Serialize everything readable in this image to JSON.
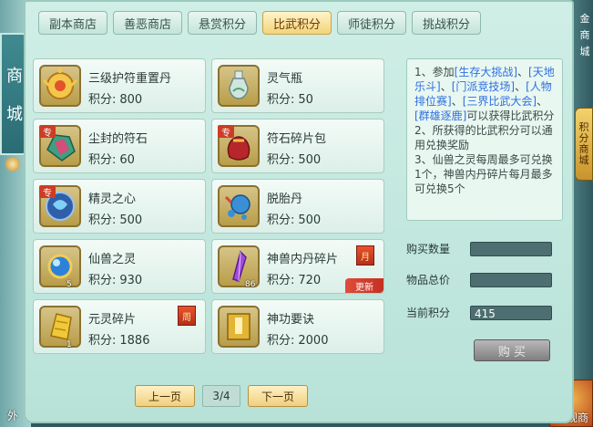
{
  "left_tab": {
    "chars": [
      "商",
      "城"
    ]
  },
  "right_top": {
    "chars": [
      "金",
      "商",
      "城"
    ]
  },
  "right_tab": {
    "chars": [
      "积",
      "分",
      "商",
      "城"
    ]
  },
  "corner": {
    "right_label": "外观商",
    "left_label": "外"
  },
  "tabs": [
    {
      "label": "副本商店",
      "active": false
    },
    {
      "label": "善恶商店",
      "active": false
    },
    {
      "label": "悬赏积分",
      "active": false
    },
    {
      "label": "比武积分",
      "active": true
    },
    {
      "label": "师徒积分",
      "active": false
    },
    {
      "label": "挑战积分",
      "active": false
    }
  ],
  "items": [
    {
      "name": "三级护符重置丹",
      "points_label": "积分:",
      "points": "800",
      "icon": "amulet-pill-icon"
    },
    {
      "name": "灵气瓶",
      "points_label": "积分:",
      "points": "50",
      "icon": "spirit-bottle-icon"
    },
    {
      "name": "尘封的符石",
      "points_label": "积分:",
      "points": "60",
      "icon": "dusty-runestone-icon",
      "badge": "专"
    },
    {
      "name": "符石碎片包",
      "points_label": "积分:",
      "points": "500",
      "icon": "rune-fragment-bag-icon",
      "badge": "专"
    },
    {
      "name": "精灵之心",
      "points_label": "积分:",
      "points": "500",
      "icon": "spirit-heart-icon",
      "badge": "专"
    },
    {
      "name": "脱胎丹",
      "points_label": "积分:",
      "points": "500",
      "icon": "rebirth-pill-icon"
    },
    {
      "name": "仙兽之灵",
      "points_label": "积分:",
      "points": "930",
      "icon": "beast-spirit-orb-icon",
      "qty": "5"
    },
    {
      "name": "神兽内丹碎片",
      "points_label": "积分:",
      "points": "720",
      "icon": "beast-core-shard-icon",
      "qty": "86",
      "tag": "月",
      "ribbon": "更新"
    },
    {
      "name": "元灵碎片",
      "points_label": "积分:",
      "points": "1886",
      "icon": "yuanling-shard-icon",
      "qty": "1",
      "tag": "周"
    },
    {
      "name": "神功要诀",
      "points_label": "积分:",
      "points": "2000",
      "icon": "manual-book-icon"
    }
  ],
  "pager": {
    "prev": "上一页",
    "page": "3/4",
    "next": "下一页"
  },
  "desc": {
    "p1_prefix": "1、参加",
    "links": [
      "[生存大挑战]",
      "[天地乐斗]",
      "[门派竞技场]",
      "[人物排位赛]",
      "[三界比武大会]",
      "[群雄逐鹿]"
    ],
    "sep": "、",
    "p1_suffix": "可以获得比武积分",
    "p2": "2、所获得的比武积分可以通用兑换奖励",
    "p3": "3、仙兽之灵每周最多可兑换1个，神兽内丹碎片每月最多可兑换5个"
  },
  "purchase": {
    "qty_label": "购买数量",
    "qty_value": "",
    "total_label": "物品总价",
    "total_value": "",
    "current_label": "当前积分",
    "current_value": "415",
    "buy_label": "购 买"
  }
}
